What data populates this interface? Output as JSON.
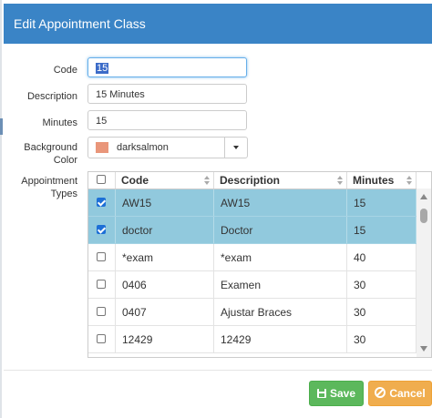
{
  "dialog": {
    "title": "Edit Appointment Class"
  },
  "form": {
    "code": {
      "label": "Code",
      "value": "15"
    },
    "description": {
      "label": "Description",
      "value": "15 Minutes"
    },
    "minutes": {
      "label": "Minutes",
      "value": "15"
    },
    "background_color": {
      "label_line1": "Background",
      "label_line2": "Color",
      "value": "darksalmon",
      "swatch": "#e9967a"
    },
    "appointment_types": {
      "label_line1": "Appointment",
      "label_line2": "Types"
    }
  },
  "grid": {
    "columns": [
      "Code",
      "Description",
      "Minutes"
    ],
    "rows": [
      {
        "checked": true,
        "code": "AW15",
        "description": "AW15",
        "minutes": "15"
      },
      {
        "checked": true,
        "code": "doctor",
        "description": "Doctor",
        "minutes": "15"
      },
      {
        "checked": false,
        "code": "*exam",
        "description": "*exam",
        "minutes": "40"
      },
      {
        "checked": false,
        "code": "0406",
        "description": "Examen",
        "minutes": "30"
      },
      {
        "checked": false,
        "code": "0407",
        "description": "Ajustar Braces",
        "minutes": "30"
      },
      {
        "checked": false,
        "code": "12429",
        "description": "12429",
        "minutes": "30"
      }
    ]
  },
  "buttons": {
    "save": "Save",
    "cancel": "Cancel"
  },
  "colors": {
    "titlebar": "#3a84c6",
    "selected_row": "#91c9dd",
    "save": "#5cb85c",
    "cancel": "#f0ad4e"
  }
}
